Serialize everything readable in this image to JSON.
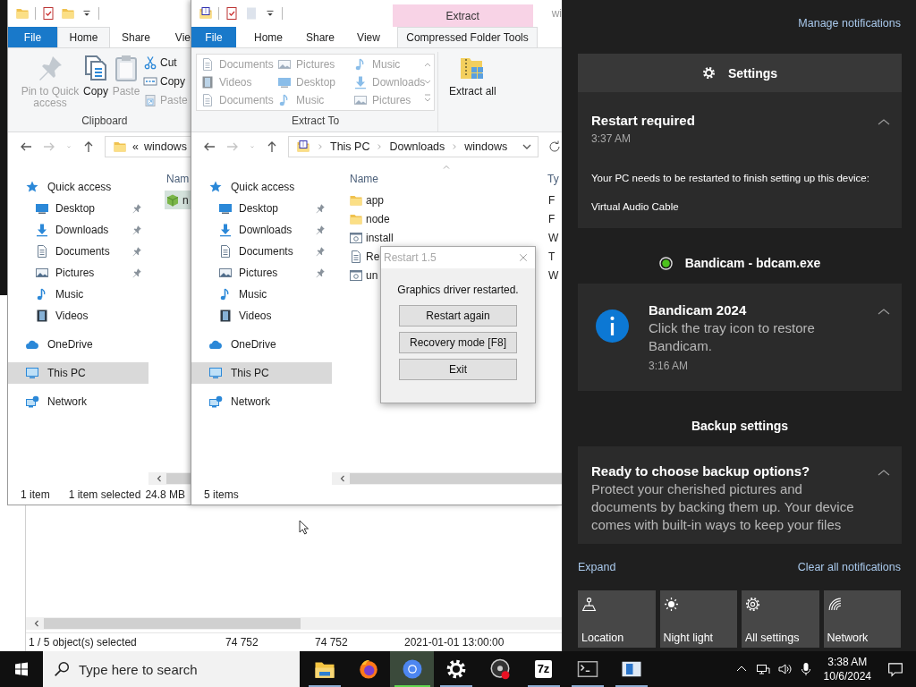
{
  "background_window": {
    "status_bar": [
      "1 / 5 object(s) selected",
      "74 752",
      "74 752",
      "2021-01-01 13:00:00"
    ]
  },
  "explorers": [
    {
      "tabs": [
        {
          "label": "File",
          "kind": "file",
          "selected": false
        },
        {
          "label": "Home",
          "kind": "tab",
          "selected": true
        },
        {
          "label": "Share",
          "kind": "tab",
          "selected": false
        },
        {
          "label": "Vie",
          "kind": "tab",
          "selected": false
        }
      ],
      "ribbon": [
        {
          "label": "Clipboard",
          "large": [
            {
              "label": "Pin to Quick access",
              "kind": "pin",
              "disabled": true
            },
            {
              "label": "Copy",
              "kind": "copy",
              "disabled": false
            },
            {
              "label": "Paste",
              "kind": "paste",
              "disabled": true
            }
          ],
          "small": [
            {
              "label": "Cut",
              "kind": "cut",
              "disabled": false
            },
            {
              "label": "Copy",
              "kind": "copy-path",
              "disabled": false
            },
            {
              "label": "Paste",
              "kind": "paste-shortcut",
              "disabled": true
            }
          ]
        }
      ],
      "address": {
        "kind": "folder",
        "prefix": "«",
        "segments": [
          "windows"
        ]
      },
      "nav": [
        {
          "label": "Quick access",
          "kind": "star",
          "selected": false,
          "children": [
            {
              "label": "Desktop",
              "kind": "desktop",
              "pinned": true,
              "selected": false
            },
            {
              "label": "Downloads",
              "kind": "download",
              "pinned": true,
              "selected": false
            },
            {
              "label": "Documents",
              "kind": "document",
              "pinned": true,
              "selected": false
            },
            {
              "label": "Pictures",
              "kind": "picture",
              "pinned": true,
              "selected": false
            },
            {
              "label": "Music",
              "kind": "music",
              "pinned": false,
              "selected": false
            },
            {
              "label": "Videos",
              "kind": "videos",
              "pinned": false,
              "selected": false
            }
          ]
        },
        {
          "label": "OneDrive",
          "kind": "cloud",
          "selected": false
        },
        {
          "label": "This PC",
          "kind": "pc",
          "selected": true
        },
        {
          "label": "Network",
          "kind": "network",
          "selected": false
        }
      ],
      "columns": [
        {
          "label": "Nam",
          "sorted": false
        }
      ],
      "rows": [
        {
          "kind": "app",
          "cells": [
            "n"
          ],
          "selected": true
        }
      ],
      "status": [
        "1 item",
        "1 item selected",
        "24.8 MB"
      ]
    },
    {
      "context_tab": "Extract",
      "title": "wi",
      "tabs": [
        {
          "label": "File",
          "kind": "file",
          "selected": false
        },
        {
          "label": "Home",
          "kind": "tab",
          "selected": false
        },
        {
          "label": "Share",
          "kind": "tab",
          "selected": false
        },
        {
          "label": "View",
          "kind": "tab",
          "selected": false
        },
        {
          "label": "Compressed Folder Tools",
          "kind": "tab",
          "selected": true
        }
      ],
      "ribbon": [
        {
          "label": "Extract To",
          "gallery": [
            {
              "label": "Documents",
              "kind": "document",
              "disabled": true
            },
            {
              "label": "Pictures",
              "kind": "picture",
              "disabled": true
            },
            {
              "label": "Music",
              "kind": "music",
              "disabled": true
            },
            {
              "label": "Videos",
              "kind": "videos",
              "disabled": true
            },
            {
              "label": "Desktop",
              "kind": "desktop",
              "disabled": true
            },
            {
              "label": "Downloads",
              "kind": "download",
              "disabled": true
            },
            {
              "label": "Documents",
              "kind": "document",
              "disabled": true
            },
            {
              "label": "Music",
              "kind": "music",
              "disabled": true
            },
            {
              "label": "Pictures",
              "kind": "picture",
              "disabled": true
            }
          ]
        },
        {
          "large": [
            {
              "label": "Extract all",
              "kind": "extract",
              "disabled": false
            }
          ]
        }
      ],
      "address": {
        "kind": "zip",
        "segments": [
          "This PC",
          "Downloads",
          "windows"
        ],
        "dropdown": true,
        "refresh": true
      },
      "nav": [
        {
          "label": "Quick access",
          "kind": "star",
          "selected": false,
          "children": [
            {
              "label": "Desktop",
              "kind": "desktop",
              "pinned": true,
              "selected": false
            },
            {
              "label": "Downloads",
              "kind": "download",
              "pinned": true,
              "selected": false
            },
            {
              "label": "Documents",
              "kind": "document",
              "pinned": true,
              "selected": false
            },
            {
              "label": "Pictures",
              "kind": "picture",
              "pinned": true,
              "selected": false
            },
            {
              "label": "Music",
              "kind": "music",
              "pinned": false,
              "selected": false
            },
            {
              "label": "Videos",
              "kind": "videos",
              "pinned": false,
              "selected": false
            }
          ]
        },
        {
          "label": "OneDrive",
          "kind": "cloud",
          "selected": false
        },
        {
          "label": "This PC",
          "kind": "pc",
          "selected": true
        },
        {
          "label": "Network",
          "kind": "network",
          "selected": false
        }
      ],
      "columns": [
        {
          "label": "Name",
          "sorted": true
        },
        {
          "label": "Ty",
          "sorted": false
        }
      ],
      "rows": [
        {
          "kind": "folder",
          "cells": [
            "app",
            "F"
          ],
          "selected": false
        },
        {
          "kind": "folder",
          "cells": [
            "node",
            "F"
          ],
          "selected": false
        },
        {
          "kind": "script",
          "cells": [
            "install",
            "W"
          ],
          "selected": false
        },
        {
          "kind": "text",
          "cells": [
            "Re",
            "T"
          ],
          "selected": false
        },
        {
          "kind": "script",
          "cells": [
            "un",
            "W"
          ],
          "selected": false
        }
      ],
      "status": [
        "5 items"
      ]
    }
  ],
  "dialog": {
    "title": "Restart 1.5",
    "message": "Graphics driver restarted.",
    "buttons": [
      "Restart again",
      "Recovery mode [F8]",
      "Exit"
    ]
  },
  "notifications": {
    "manage": "Manage notifications",
    "groups": [
      {
        "header": "Settings",
        "kind": "system",
        "items": [
          {
            "kind": "plain",
            "expanded": true,
            "lines": [
              {
                "kind": "title",
                "text": "Restart required"
              },
              {
                "kind": "time",
                "text": "3:37 AM"
              },
              {
                "kind": "detail",
                "text": "Your PC needs to be restarted to finish setting up this device:"
              },
              {
                "kind": "detail",
                "text": "Virtual Audio Cable"
              }
            ]
          }
        ]
      },
      {
        "header": "Bandicam - bdcam.exe",
        "kind": "app",
        "items": [
          {
            "kind": "info",
            "expanded": true,
            "lines": [
              {
                "kind": "title",
                "text": "Bandicam 2024"
              },
              {
                "kind": "body",
                "text": "Click the tray icon to restore Bandicam."
              },
              {
                "kind": "time",
                "text": "3:16 AM"
              }
            ]
          }
        ]
      },
      {
        "header": "Backup settings",
        "kind": "section",
        "items": [
          {
            "kind": "plain",
            "expanded": true,
            "lines": [
              {
                "kind": "title",
                "text": "Ready to choose backup options?"
              },
              {
                "kind": "body",
                "text": "Protect your cherished pictures and documents by backing them up. Your device comes with built-in ways to keep your files"
              }
            ]
          }
        ]
      }
    ],
    "expand": "Expand",
    "clear": "Clear all notifications",
    "quick_actions": [
      {
        "label": "Location",
        "kind": "location",
        "on": false
      },
      {
        "label": "Night light",
        "kind": "sun",
        "on": false
      },
      {
        "label": "All settings",
        "kind": "gear-outline",
        "on": false
      },
      {
        "label": "Network",
        "kind": "wifi",
        "on": false
      }
    ]
  },
  "taskbar": {
    "search": {
      "placeholder": "Type here to search"
    },
    "apps": [
      {
        "kind": "explorer",
        "running": true,
        "active": false
      },
      {
        "kind": "firefox",
        "running": false,
        "active": false
      },
      {
        "kind": "chrome",
        "running": true,
        "active": true
      },
      {
        "kind": "gear",
        "running": true,
        "active": false
      },
      {
        "kind": "record",
        "running": false,
        "active": false
      },
      {
        "kind": "archiver",
        "label": "7z",
        "running": true,
        "active": false
      },
      {
        "kind": "terminal",
        "running": true,
        "active": false
      },
      {
        "kind": "window",
        "running": true,
        "active": false
      }
    ],
    "time": "3:38 AM",
    "date": "10/6/2024"
  }
}
